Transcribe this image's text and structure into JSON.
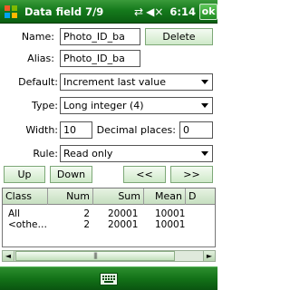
{
  "titlebar": {
    "title": "Data field 7/9",
    "time": "6:14",
    "ok_label": "ok",
    "icons": [
      "windows-start-icon",
      "connectivity-icon",
      "volume-icon"
    ]
  },
  "form": {
    "name_label": "Name:",
    "name_value": "Photo_ID_ba",
    "delete_label": "Delete",
    "alias_label": "Alias:",
    "alias_value": "Photo_ID_ba",
    "default_label": "Default:",
    "default_value": "Increment last value",
    "type_label": "Type:",
    "type_value": "Long integer (4)",
    "width_label": "Width:",
    "width_value": "10",
    "decimal_label": "Decimal places:",
    "decimal_value": "0",
    "rule_label": "Rule:",
    "rule_value": "Read only"
  },
  "nav": {
    "up": "Up",
    "down": "Down",
    "prev": "<<",
    "next": ">>"
  },
  "table": {
    "columns": [
      "Class",
      "Num",
      "Sum",
      "Mean",
      "D"
    ],
    "rows": [
      [
        "All",
        "2",
        "20001",
        "10001"
      ],
      [
        "<othe…",
        "2",
        "20001",
        "10001"
      ]
    ]
  },
  "scrollbar": {
    "left_arrow": "◄",
    "right_arrow": "►",
    "thumb_grip": "|||"
  },
  "colors": {
    "titlebar": "#157a1c",
    "button_bg": "#cfe9c9"
  }
}
